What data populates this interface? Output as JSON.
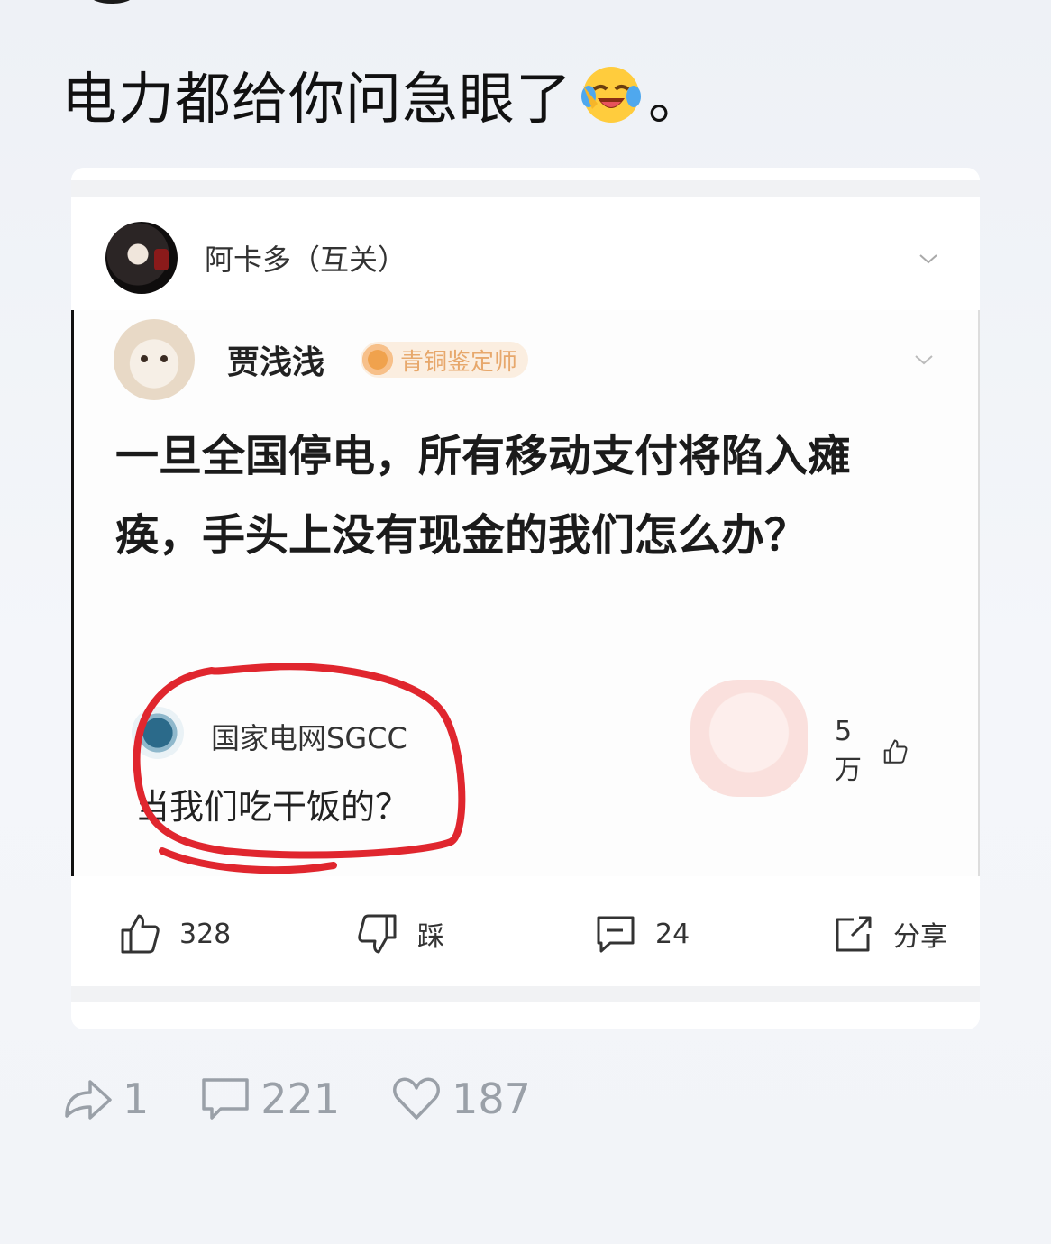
{
  "caption": {
    "text": "电力都给你问急眼了",
    "suffix": "。",
    "emoji": "laughing-crying-emoji"
  },
  "repost": {
    "author": "阿卡多（互关）"
  },
  "screenshot": {
    "author": "贾浅浅",
    "badge": "青铜鉴定师",
    "question": "一旦全国停电，所有移动支付将陷入瘫痪，手头上没有现金的我们怎么办？",
    "reply": {
      "author": "国家电网SGCC",
      "text": "当我们吃干饭的？",
      "likes": "5万"
    }
  },
  "actions": {
    "like_count": "328",
    "dislike_label": "踩",
    "comment_count": "24",
    "share_label": "分享"
  },
  "footer": {
    "reposts": "1",
    "comments": "221",
    "likes": "187"
  },
  "colors": {
    "circle": "#e0262e",
    "badge": "#f0a24d",
    "muted": "#9aa0a8"
  }
}
